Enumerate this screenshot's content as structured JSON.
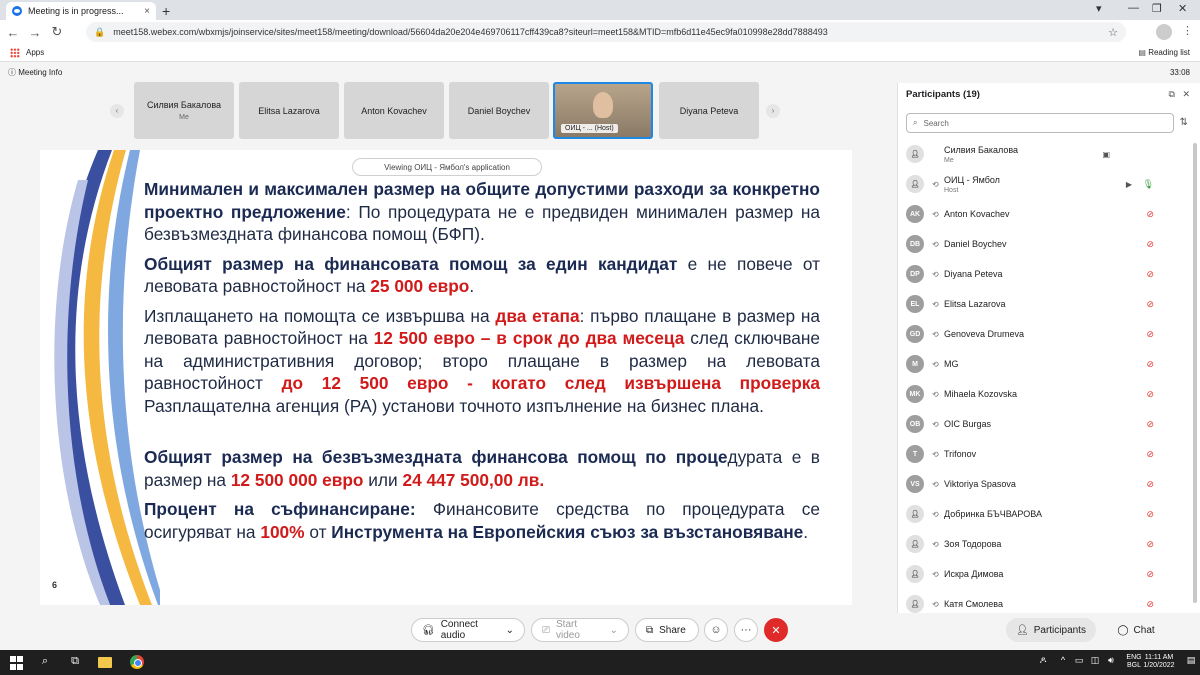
{
  "browser": {
    "tab_title": "Meeting is in progress...",
    "tab_close": "×",
    "new_tab": "+",
    "url": "meet158.webex.com/wbxmjs/joinservice/sites/meet158/meeting/download/56604da20e204e469706117cff439ca8?siteurl=meet158&MTID=mfb6d11e45ec9fa010998e28dd7888493",
    "bookmarks_apps": "Apps",
    "reading_list": "Reading list"
  },
  "meeting": {
    "info_label": "Meeting Info",
    "timer": "33:08",
    "viewing_label": "Viewing ОИЦ - Ямбол's application"
  },
  "video_strip": [
    {
      "name": "Силвия Бакалова",
      "sub": "Me"
    },
    {
      "name": "Elitsa Lazarova",
      "sub": ""
    },
    {
      "name": "Anton Kovachev",
      "sub": ""
    },
    {
      "name": "Daniel Boychev",
      "sub": ""
    },
    {
      "name": "ОИЦ - ... (Host)",
      "sub": ""
    },
    {
      "name": "Diyana Peteva",
      "sub": ""
    }
  ],
  "slide": {
    "p1_bold": "Минимален и максимален размер на общите допустими разходи за конкретно проектно предложение",
    "p1_rest": ": По процедурата не е предвиден минимален размер на безвъзмездната финансова помощ (БФП).",
    "p2_bold": "Общият размер на финансовата помощ за един кандидат",
    "p2_mid": " е не повече от левовата равностойност на ",
    "p2_red": "25 000 евро",
    "p2_end": ".",
    "p3_a": "Изплащането на помощта се извършва на ",
    "p3_red1": "два етапа",
    "p3_b": ": първо плащане в размер на левовата равностойност на ",
    "p3_red2": "12 500 евро – в срок до два месеца",
    "p3_c": " след сключване на административния договор; второ плащане в размер на левовата равностойност ",
    "p3_red3": "до 12 500 евро - когато след извършена проверка",
    "p3_d": " Разплащателна агенция (РА) установи точното изпълнение на бизнес плана.",
    "p4_bold": "Общият размер на безвъзмездната финансова помощ по проце",
    "p4_rest": "дурата е в размер на ",
    "p4_red1": "12 500 000 евро",
    "p4_or": " или ",
    "p4_red2": "24 447 500,00 лв.",
    "p5_bold": "Процент на съфинансиране:",
    "p5_a": " Финансовите средства по процедурата се осигуряват на ",
    "p5_red": "100%",
    "p5_b": " от ",
    "p5_bold2": "Инструмента на Европейския съюз за възстановяване",
    "p5_end": ".",
    "page_number": "6"
  },
  "controls": {
    "connect_audio": "Connect audio",
    "start_video": "Start video",
    "share": "Share",
    "more": "···",
    "end": "✕",
    "participants_tab": "Participants",
    "chat_tab": "Chat"
  },
  "participants": {
    "title": "Participants (19)",
    "search_placeholder": "Search",
    "list": [
      {
        "initials": "",
        "name": "Силвия Бакалова",
        "sub": "Me",
        "person": true
      },
      {
        "initials": "",
        "name": "ОИЦ - Ямбол",
        "sub": "Host",
        "person": true
      },
      {
        "initials": "AK",
        "name": "Anton Kovachev",
        "sub": "",
        "person": false
      },
      {
        "initials": "DB",
        "name": "Daniel Boychev",
        "sub": "",
        "person": false
      },
      {
        "initials": "DP",
        "name": "Diyana Peteva",
        "sub": "",
        "person": false
      },
      {
        "initials": "EL",
        "name": "Elitsa Lazarova",
        "sub": "",
        "person": false
      },
      {
        "initials": "GD",
        "name": "Genoveva Drumeva",
        "sub": "",
        "person": false
      },
      {
        "initials": "M",
        "name": "MG",
        "sub": "",
        "person": false
      },
      {
        "initials": "MK",
        "name": "Mihaela Kozovska",
        "sub": "",
        "person": false
      },
      {
        "initials": "OB",
        "name": "OIC Burgas",
        "sub": "",
        "person": false
      },
      {
        "initials": "T",
        "name": "Trifonov",
        "sub": "",
        "person": false
      },
      {
        "initials": "VS",
        "name": "Viktoriya Spasova",
        "sub": "",
        "person": false
      },
      {
        "initials": "",
        "name": "Добринка БЪЧВАРОВА",
        "sub": "",
        "person": true
      },
      {
        "initials": "",
        "name": "Зоя Тодорова",
        "sub": "",
        "person": true
      },
      {
        "initials": "",
        "name": "Искра Димова",
        "sub": "",
        "person": true
      },
      {
        "initials": "",
        "name": "Катя Смолева",
        "sub": "",
        "person": true
      }
    ]
  },
  "taskbar": {
    "lang": "ENG",
    "lang2": "BGL",
    "time": "11:11 AM",
    "date": "1/20/2022"
  },
  "colors": {
    "end_button": "#e02a2a",
    "slide_red": "#d11a1a",
    "slide_navy": "#1b2a52",
    "accent_blue": "#1e88e5"
  }
}
